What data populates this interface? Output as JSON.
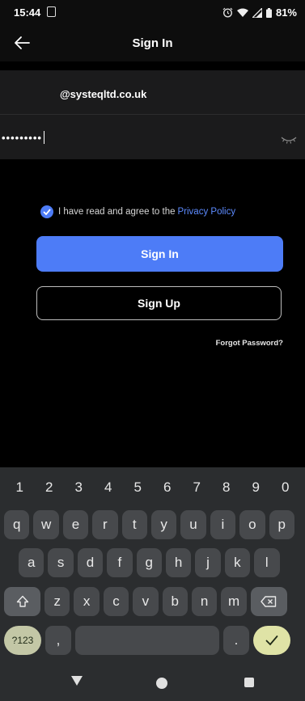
{
  "status_bar": {
    "time": "15:44",
    "battery": "81%",
    "icons": [
      "screenshot-icon",
      "alarm-icon",
      "wifi-icon",
      "signal-icon",
      "battery-icon"
    ]
  },
  "header": {
    "title": "Sign In",
    "back_icon": "arrow-left-icon"
  },
  "form": {
    "email_value": "@systeqltd.co.uk",
    "password_value": "•••••••••",
    "password_toggle_icon": "eye-closed-icon"
  },
  "agreement": {
    "text": "I have read and agree to the",
    "link_text": "Privacy Policy",
    "checked": true
  },
  "buttons": {
    "sign_in": "Sign In",
    "sign_up": "Sign Up",
    "forgot_password": "Forgot Password?"
  },
  "colors": {
    "accent": "#4d7cf7",
    "link": "#5d8bff",
    "background": "#000000",
    "panel": "#1b1b1c"
  },
  "keyboard": {
    "numbers": [
      "1",
      "2",
      "3",
      "4",
      "5",
      "6",
      "7",
      "8",
      "9",
      "0"
    ],
    "row1": [
      "q",
      "w",
      "e",
      "r",
      "t",
      "y",
      "u",
      "i",
      "o",
      "p"
    ],
    "row2": [
      "a",
      "s",
      "d",
      "f",
      "g",
      "h",
      "j",
      "k",
      "l"
    ],
    "row3": [
      "z",
      "x",
      "c",
      "v",
      "b",
      "n",
      "m"
    ],
    "symbols_key": "?123",
    "comma_key": ",",
    "period_key": "."
  }
}
